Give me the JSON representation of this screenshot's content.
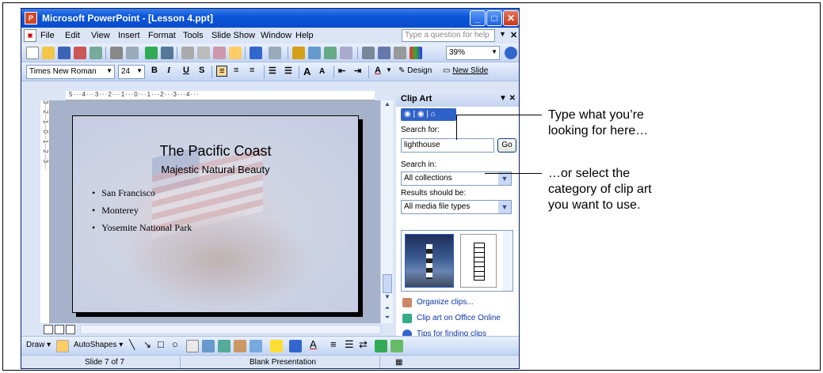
{
  "window": {
    "title": "Microsoft PowerPoint - [Lesson 4.ppt]",
    "app_icon": "P"
  },
  "menu": {
    "items": [
      "File",
      "Edit",
      "View",
      "Insert",
      "Format",
      "Tools",
      "Slide Show",
      "Window",
      "Help"
    ],
    "help_placeholder": "Type a question for help"
  },
  "standard_toolbar": {
    "zoom": "39%"
  },
  "formatting_toolbar": {
    "font": "Times New Roman",
    "size": "24",
    "bold": "B",
    "italic": "I",
    "underline": "U",
    "shadow": "S",
    "grow_font": "A",
    "shrink_font": "A",
    "font_color": "A",
    "design": "Design",
    "new_slide": "New Slide"
  },
  "ruler": {
    "horizontal": "5···4···3···2···1···0···1···2···3···4···",
    "vertical": "3···2···1···0···1···2···3···"
  },
  "slide": {
    "title": "The Pacific Coast",
    "subtitle": "Majestic Natural Beauty",
    "bullets": [
      "San Francisco",
      "Monterey",
      "Yosemite National Park"
    ]
  },
  "task_pane": {
    "title": "Clip Art",
    "search_for_label": "Search for:",
    "search_value": "lighthouse",
    "go_label": "Go",
    "search_in_label": "Search in:",
    "search_in_value": "All collections",
    "results_label": "Results should be:",
    "results_value": "All media file types",
    "links": [
      "Organize clips...",
      "Clip art on Office Online",
      "Tips for finding clips"
    ]
  },
  "draw_toolbar": {
    "draw": "Draw",
    "autoshapes": "AutoShapes"
  },
  "status": {
    "slide": "Slide 7 of 7",
    "template": "Blank Presentation"
  },
  "callouts": {
    "first": [
      "Type what you’re",
      "looking for here…"
    ],
    "second": [
      "…or select the",
      "category of clip art",
      "you want to use."
    ]
  },
  "colors": {
    "titlebar": "#0b55d9",
    "link": "#0b36a8",
    "slide_bg": "#c4cbe3"
  }
}
